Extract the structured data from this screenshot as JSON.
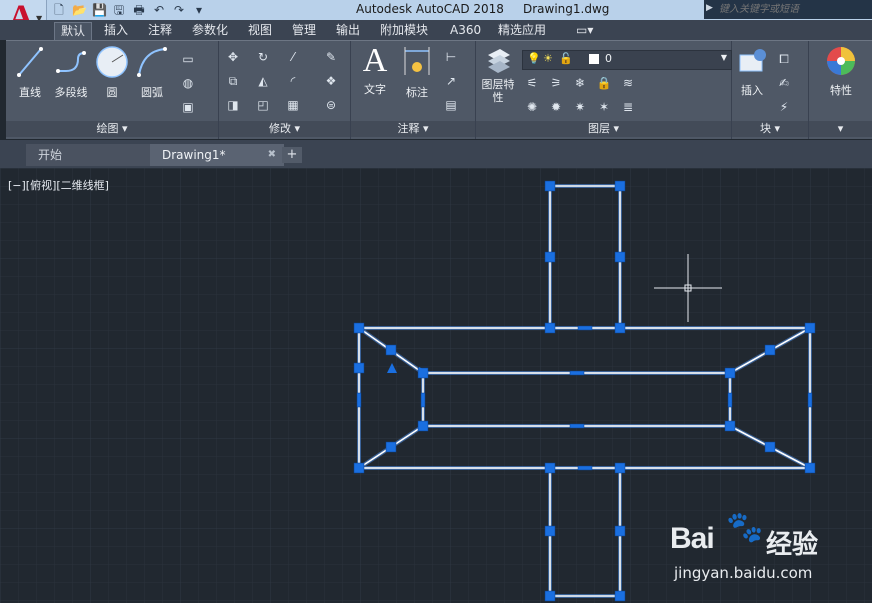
{
  "titlebar": {
    "app_name": "Autodesk AutoCAD 2018",
    "file_name": "Drawing1.dwg",
    "search_placeholder": "键入关键字或短语"
  },
  "ribbon_tabs": [
    "默认",
    "插入",
    "注释",
    "参数化",
    "视图",
    "管理",
    "输出",
    "附加模块",
    "A360",
    "精选应用"
  ],
  "ribbon": {
    "draw_panel": {
      "title": "绘图",
      "tools": [
        "直线",
        "多段线",
        "圆",
        "圆弧"
      ]
    },
    "modify_panel": {
      "title": "修改"
    },
    "annotation_panel": {
      "title": "注释",
      "tools": [
        "文字",
        "标注"
      ]
    },
    "layers_panel": {
      "title": "图层",
      "tools": [
        "图层特性"
      ],
      "current_layer": "0"
    },
    "block_panel": {
      "title": "块",
      "tools": [
        "插入"
      ]
    },
    "properties_panel": {
      "title": "特性"
    }
  },
  "doc_tabs": [
    {
      "label": "开始",
      "active": false
    },
    {
      "label": "Drawing1*",
      "active": true
    }
  ],
  "viewport": {
    "view_label": "[−][俯视][二维线框]"
  },
  "watermark": {
    "brand": "Bai",
    "brand_cn": "经验",
    "url": "jingyan.baidu.com"
  },
  "colors": {
    "canvas": "#212830",
    "geometry": "#ffffff",
    "grip": "#1a6fe0",
    "ribbon": "#4f5866"
  }
}
